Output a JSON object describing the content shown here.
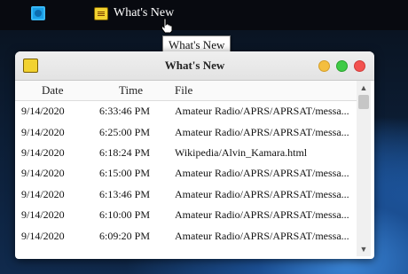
{
  "menubar": {
    "menu_item_label": "What's New",
    "tooltip": "What's New"
  },
  "window": {
    "title": "What's New",
    "columns": [
      "Date",
      "Time",
      "File"
    ],
    "rows": [
      [
        "9/14/2020",
        "6:33:46 PM",
        "Amateur Radio/APRS/APRSAT/messa..."
      ],
      [
        "9/14/2020",
        "6:25:00 PM",
        "Amateur Radio/APRS/APRSAT/messa..."
      ],
      [
        "9/14/2020",
        "6:18:24 PM",
        "Wikipedia/Alvin_Kamara.html"
      ],
      [
        "9/14/2020",
        "6:15:00 PM",
        "Amateur Radio/APRS/APRSAT/messa..."
      ],
      [
        "9/14/2020",
        "6:13:46 PM",
        "Amateur Radio/APRS/APRSAT/messa..."
      ],
      [
        "9/14/2020",
        "6:10:00 PM",
        "Amateur Radio/APRS/APRSAT/messa..."
      ],
      [
        "9/14/2020",
        "6:09:20 PM",
        "Amateur Radio/APRS/APRSAT/messa..."
      ]
    ]
  },
  "icons": {
    "app": "app-icon",
    "whats_new": "whats-new-icon",
    "cursor": "pointer-hand-cursor-icon",
    "scroll_up": "chevron-up-icon",
    "scroll_down": "chevron-down-icon"
  },
  "colors": {
    "close": "#f3524f",
    "minimize": "#f4be3f",
    "maximize": "#3fcb46"
  }
}
